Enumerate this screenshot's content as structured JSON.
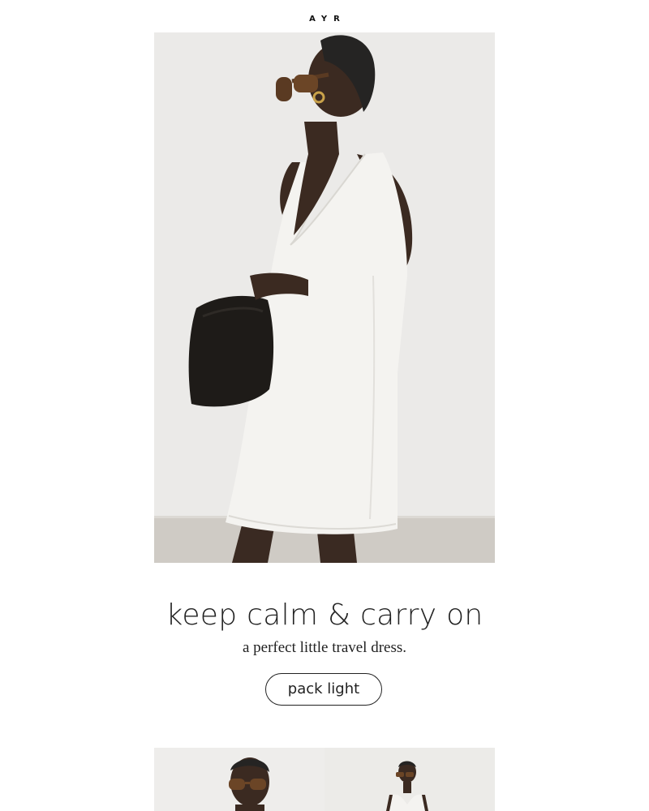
{
  "brand": {
    "logo_text": "AYR"
  },
  "hero": {
    "image_alt": "Model in a white sleeveless mini dress holding a black bag, wearing sunglasses"
  },
  "promo": {
    "headline": "keep calm & carry on",
    "subheadline": "a perfect little travel dress.",
    "cta_label": "pack light"
  },
  "product_tiles": [
    {
      "image_alt": "Model wearing tortoiseshell sunglasses"
    },
    {
      "image_alt": "Model in white sleeveless dress, full length"
    }
  ],
  "colors": {
    "background": "#ffffff",
    "text": "#222222",
    "hero_backdrop": "#e9e8e6",
    "dress": "#f4f3f0",
    "bag": "#1e1b18"
  }
}
